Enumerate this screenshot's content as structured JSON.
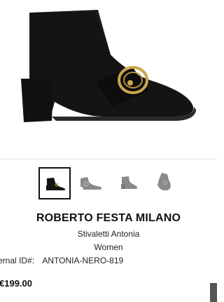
{
  "product": {
    "brand": "ROBERTO FESTA MILANO",
    "name": "Stivaletti Antonia",
    "category": "Women",
    "external_id_label": "ernal ID#:",
    "external_id_value": "ANTONIA-NERO-819",
    "price": "€199.00"
  },
  "gallery": {
    "main_image": "black-suede-ankle-boot-with-gold-buckle",
    "thumbnails": [
      {
        "icon": "boot-side-view-thumbnail",
        "selected": true
      },
      {
        "icon": "boot-front-view-thumbnail",
        "selected": false
      },
      {
        "icon": "boot-back-view-thumbnail",
        "selected": false
      },
      {
        "icon": "boot-angle-view-thumbnail",
        "selected": false
      }
    ]
  },
  "colors": {
    "boot": "#141414",
    "buckle": "#c9a64a",
    "thumb_gray": "#8a8a8a"
  }
}
